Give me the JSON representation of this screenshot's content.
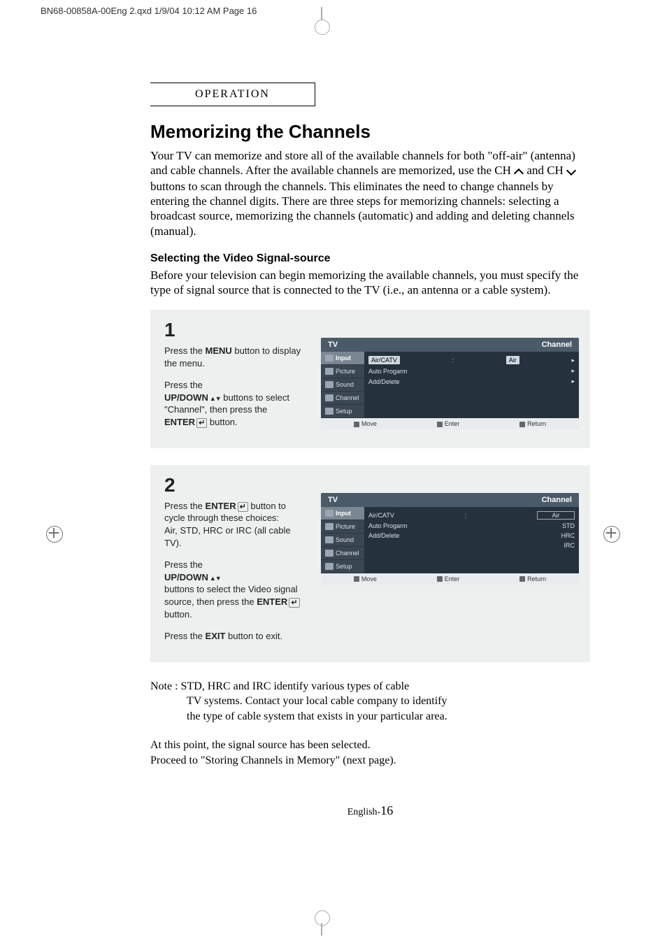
{
  "print_header": "BN68-00858A-00Eng 2.qxd   1/9/04 10:12 AM   Page 16",
  "section_tab": "OPERATION",
  "title": "Memorizing the Channels",
  "intro_a": "Your TV can memorize and store all of the available channels for both \"off-air\" (antenna) and cable channels. After the available channels are memorized, use the CH ",
  "intro_b": " and CH ",
  "intro_c": " buttons to scan through the channels. This eliminates the need to change channels by entering the channel digits. There are three steps for memorizing channels: selecting a broadcast source, memorizing the channels (automatic) and adding and deleting channels (manual).",
  "subhead": "Selecting the Video Signal-source",
  "subdesc": "Before your television can begin memorizing the available channels, you must specify the type of signal source that is connected to the TV (i.e., an antenna or a cable system).",
  "step1": {
    "num": "1",
    "p1a": "Press the ",
    "p1b": "MENU",
    "p1c": " button to display the menu.",
    "p2a": "Press the ",
    "p2b": "UP/DOWN",
    "p2c": " buttons to select \"Channel\", then press the ",
    "p2d": "ENTER",
    "p2e": " button."
  },
  "step2": {
    "num": "2",
    "p1a": "Press the ",
    "p1b": "ENTER",
    "p1c": " button to cycle  through these choices:",
    "p1d": "Air, STD, HRC or IRC (all cable TV).",
    "p2a": "Press the ",
    "p2b": "UP/DOWN",
    "p2c": " buttons to select the Video signal source, then press the ",
    "p2d": "ENTER",
    "p2e": " button.",
    "p3a": "Press the ",
    "p3b": "EXIT",
    "p3c": " button to exit."
  },
  "osd": {
    "head_left": "TV",
    "head_right": "Channel",
    "tabs": [
      "Input",
      "Picture",
      "Sound",
      "Channel",
      "Setup"
    ],
    "rows1": [
      {
        "label": "Air/CATV",
        "value": "Air",
        "hl": true
      },
      {
        "label": "Auto Progarm",
        "value": "",
        "hl": false
      },
      {
        "label": "Add/Delete",
        "value": "",
        "hl": false
      }
    ],
    "options": [
      "Air",
      "STD",
      "HRC",
      "IRC"
    ],
    "foot": [
      "Move",
      "Enter",
      "Return"
    ]
  },
  "note_lead": "Note : ",
  "note_l1": "STD, HRC and IRC  identify various types of cable",
  "note_l2": "TV systems. Contact your local cable company to identify",
  "note_l3": "the type of cable system that exists in your particular area.",
  "closing1": "At this point, the signal source has been selected.",
  "closing2": "Proceed to \"Storing Channels in Memory\" (next page).",
  "pagenum_prefix": "English-",
  "pagenum": "16"
}
